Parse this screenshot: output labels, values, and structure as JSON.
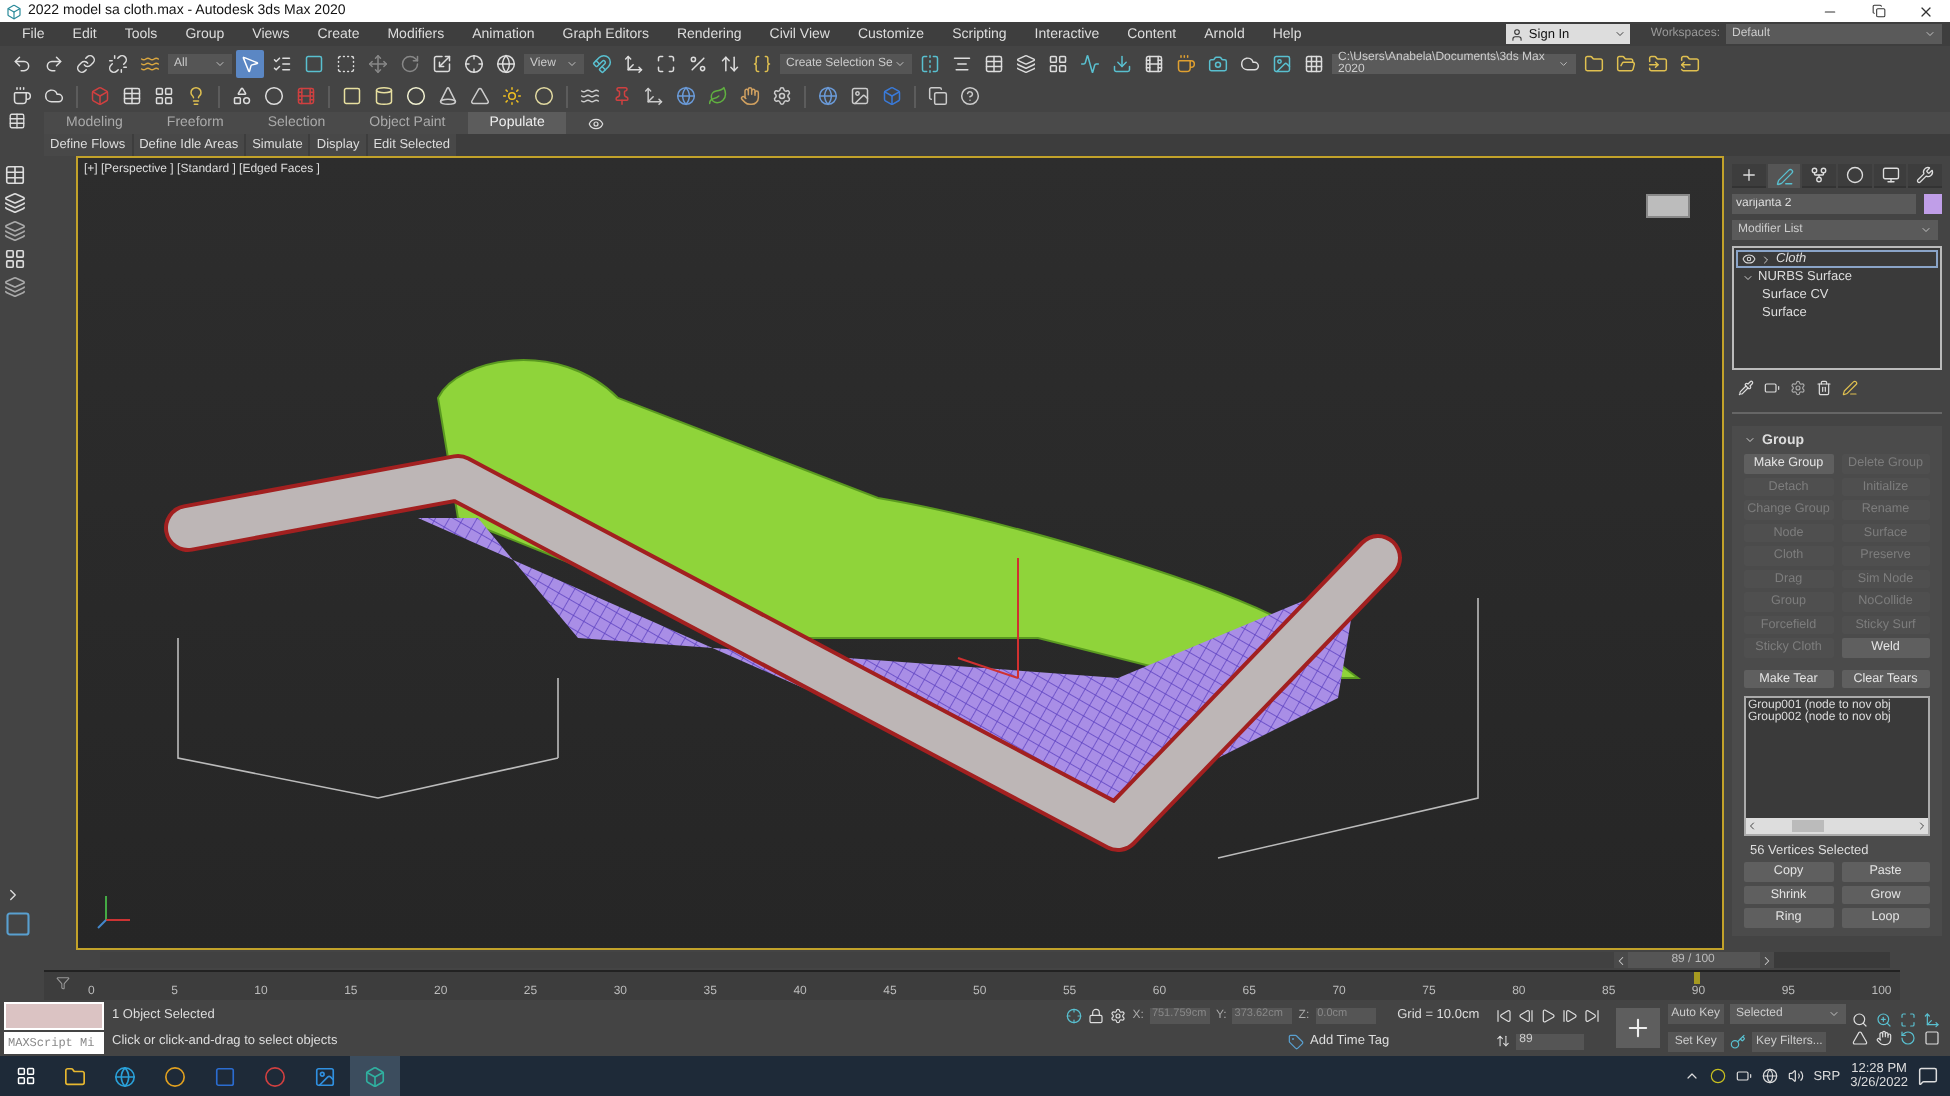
{
  "window": {
    "title": "2022 model sa cloth.max - Autodesk 3ds Max 2020"
  },
  "menu": [
    "File",
    "Edit",
    "Tools",
    "Group",
    "Views",
    "Create",
    "Modifiers",
    "Animation",
    "Graph Editors",
    "Rendering",
    "Civil View",
    "Customize",
    "Scripting",
    "Interactive",
    "Content",
    "Arnold",
    "Help"
  ],
  "account": {
    "sign_in": "Sign In",
    "workspaces_label": "Workspaces:",
    "workspace": "Default"
  },
  "toolbar": {
    "selection_filter": "All",
    "reference_coordinate": "View",
    "named_selection": "Create Selection Se",
    "project_path": "C:\\Users\\Anabela\\Documents\\3ds Max 2020"
  },
  "ribbon": {
    "tabs": [
      {
        "label": "Modeling",
        "selected": false
      },
      {
        "label": "Freeform",
        "selected": false
      },
      {
        "label": "Selection",
        "selected": false
      },
      {
        "label": "Object Paint",
        "selected": false
      },
      {
        "label": "Populate",
        "selected": true
      }
    ],
    "buttons": [
      "Define Flows",
      "Define Idle Areas",
      "Simulate",
      "Display",
      "Edit Selected"
    ]
  },
  "viewport": {
    "label": "[+] [Perspective ] [Standard ] [Edged Faces ]"
  },
  "command_panel": {
    "tabs": [
      {
        "selected": false
      },
      {
        "selected": true
      },
      {
        "selected": false
      },
      {
        "selected": false
      },
      {
        "selected": false
      },
      {
        "selected": false
      }
    ],
    "object_name": "varijanta 2",
    "modifier_list": "Modifier List",
    "modifier_stack": [
      {
        "label": "Cloth",
        "selected": true,
        "expanded": false
      },
      {
        "label": "NURBS Surface",
        "selected": false,
        "expanded": true,
        "children": [
          {
            "label": "Surface CV",
            "selected": false
          },
          {
            "label": "Surface",
            "selected": false
          }
        ]
      }
    ],
    "rollout_title": "Group",
    "group_buttons": [
      {
        "label": "Make Group",
        "disabled": false
      },
      {
        "label": "Delete Group",
        "disabled": true
      },
      {
        "label": "Detach",
        "disabled": true
      },
      {
        "label": "Initialize",
        "disabled": true
      },
      {
        "label": "Change Group",
        "disabled": true
      },
      {
        "label": "Rename",
        "disabled": true
      },
      {
        "label": "Node",
        "disabled": true
      },
      {
        "label": "Surface",
        "disabled": true
      },
      {
        "label": "Cloth",
        "disabled": true
      },
      {
        "label": "Preserve",
        "disabled": true
      },
      {
        "label": "Drag",
        "disabled": true
      },
      {
        "label": "Sim Node",
        "disabled": true
      },
      {
        "label": "Group",
        "disabled": true
      },
      {
        "label": "NoCollide",
        "disabled": true
      },
      {
        "label": "Forcefield",
        "disabled": true
      },
      {
        "label": "Sticky Surf",
        "disabled": true
      },
      {
        "label": "Sticky Cloth",
        "disabled": true
      },
      {
        "label": "Weld",
        "disabled": false
      }
    ],
    "tear_buttons": [
      "Make Tear",
      "Clear Tears"
    ],
    "group_list": [
      "Group001 (node  to  nov obj",
      "Group002 (node  to  nov obj"
    ],
    "vertices_selected": "56 Vertices Selected",
    "selection_buttons": [
      "Copy",
      "Paste",
      "Shrink",
      "Grow",
      "Ring",
      "Loop"
    ]
  },
  "timeline": {
    "frame": "89 / 100",
    "level": 0.89,
    "ticks": [
      "0",
      "5",
      "10",
      "15",
      "20",
      "25",
      "30",
      "35",
      "40",
      "45",
      "50",
      "55",
      "60",
      "65",
      "70",
      "75",
      "80",
      "85",
      "90",
      "95",
      "100"
    ]
  },
  "status": {
    "maxscript": "MAXScript Mi",
    "selection": "1 Object Selected",
    "prompt": "Click or click-and-drag to select objects",
    "coords": [
      {
        "label": "X:",
        "value": "751.759cm"
      },
      {
        "label": "Y:",
        "value": "373.62cm"
      },
      {
        "label": "Z:",
        "value": "0.0cm"
      }
    ],
    "grid": "Grid = 10.0cm",
    "add_time_tag": "Add Time Tag",
    "current_frame": "89",
    "auto_key": "Auto Key",
    "set_key": "Set Key",
    "key_mode": "Selected",
    "key_filters": "Key Filters..."
  },
  "taskbar": {
    "language": "SRP",
    "time": "12:28 PM",
    "date": "3/26/2022"
  }
}
